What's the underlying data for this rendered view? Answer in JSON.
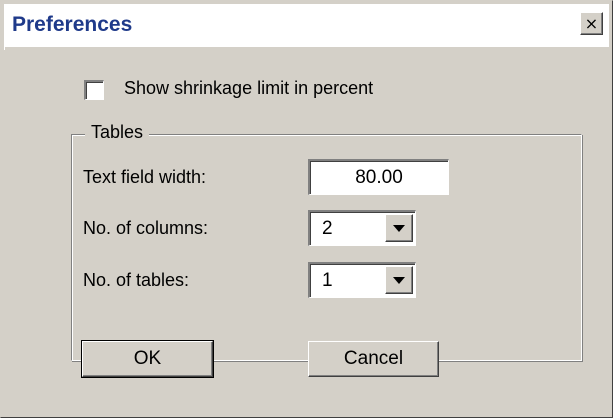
{
  "window": {
    "title": "Preferences",
    "close_glyph": "×"
  },
  "options": {
    "show_shrinkage_label": "Show shrinkage limit in percent",
    "show_shrinkage_checked": false
  },
  "tables_group": {
    "legend": "Tables",
    "text_field_width_label": "Text field width:",
    "text_field_width_value": "80.00",
    "columns_label": "No. of columns:",
    "columns_value": "2",
    "tables_label": "No. of tables:",
    "tables_value": "1"
  },
  "buttons": {
    "ok_label": "OK",
    "cancel_label": "Cancel"
  },
  "icons": {
    "close": "close-icon",
    "dropdown": "chevron-down-icon"
  }
}
